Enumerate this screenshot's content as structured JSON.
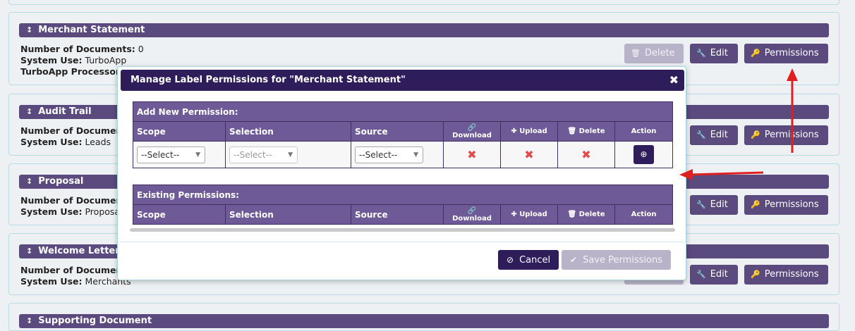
{
  "sections": [
    {
      "title": "Merchant Statement",
      "info": [
        {
          "label": "Number of Documents:",
          "value": "0"
        },
        {
          "label": "System Use:",
          "value": "TurboApp"
        },
        {
          "label": "TurboApp Processors:",
          "value": ""
        }
      ]
    },
    {
      "title": "Audit Trail",
      "info": [
        {
          "label": "Number of Documen",
          "value": ""
        },
        {
          "label": "System Use:",
          "value": "Leads"
        }
      ]
    },
    {
      "title": "Proposal",
      "info": [
        {
          "label": "Number of Documen",
          "value": ""
        },
        {
          "label": "System Use:",
          "value": "Proposal"
        }
      ]
    },
    {
      "title": "Welcome Letter",
      "info": [
        {
          "label": "Number of Documen",
          "value": ""
        },
        {
          "label": "System Use:",
          "value": "Merchants"
        }
      ]
    },
    {
      "title": "Supporting Document",
      "info": []
    }
  ],
  "buttons": {
    "delete": "Delete",
    "edit": "Edit",
    "permissions": "Permissions"
  },
  "modal": {
    "title": "Manage Label Permissions for \"Merchant Statement\"",
    "close": "✖",
    "add_section": "Add New Permission:",
    "existing_section": "Existing Permissions:",
    "columns": {
      "scope": "Scope",
      "selection": "Selection",
      "source": "Source",
      "download": "Download",
      "upload": "Upload",
      "delete": "Delete",
      "action": "Action"
    },
    "row": {
      "scope": "--Select--",
      "selection": "--Select--",
      "source": "--Select--"
    },
    "cancel": "Cancel",
    "save": "Save Permissions"
  },
  "colors": {
    "accent": "#5b4a7e",
    "modal_header": "#2f1c5a",
    "arrow": "#e02020",
    "x": "#e04a4a"
  }
}
